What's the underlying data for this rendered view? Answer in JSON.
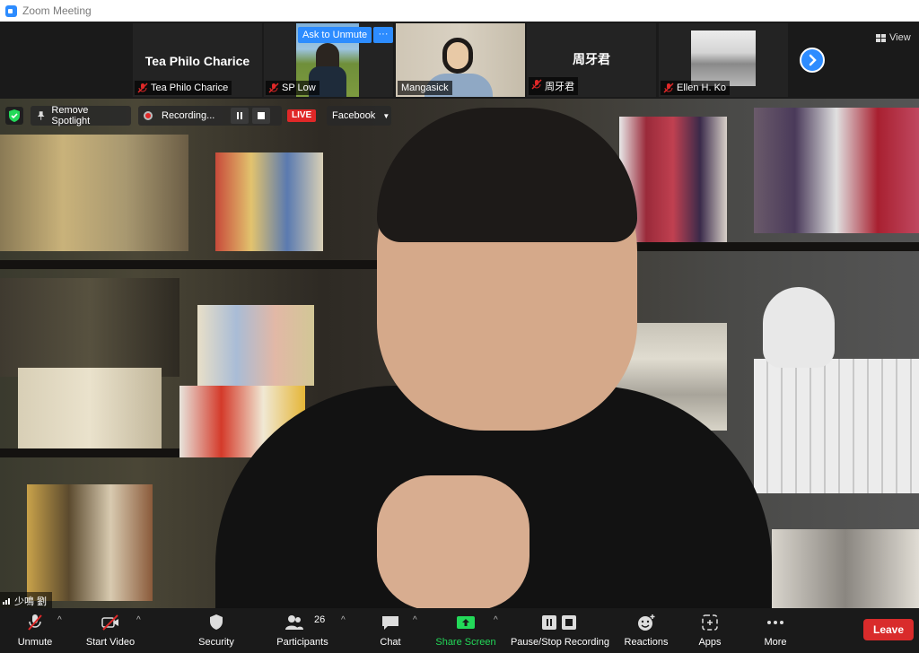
{
  "window": {
    "title": "Zoom Meeting"
  },
  "gallery": {
    "tiles": [
      {
        "name": "Tea Philo Charice",
        "center_name": "Tea Philo Charice",
        "muted": true
      },
      {
        "name": "SP Low",
        "muted": true,
        "ask_unmute": "Ask to Unmute",
        "more": "···"
      },
      {
        "name": "Mangasick",
        "muted": false
      },
      {
        "name": "周牙君",
        "center_name": "周牙君",
        "muted": true
      },
      {
        "name": "Ellen H. Ko",
        "muted": true
      }
    ],
    "view_label": "View"
  },
  "spotlight": {
    "remove_label": "Remove Spotlight",
    "recording_label": "Recording...",
    "live_badge": "LIVE",
    "stream_target": "Facebook",
    "speaker_name": "少鳴 劉"
  },
  "toolbar": {
    "unmute": "Unmute",
    "start_video": "Start Video",
    "security": "Security",
    "participants": "Participants",
    "participants_count": "26",
    "chat": "Chat",
    "share_screen": "Share Screen",
    "pause_stop_recording": "Pause/Stop Recording",
    "reactions": "Reactions",
    "apps": "Apps",
    "more": "More",
    "leave": "Leave"
  },
  "colors": {
    "accent": "#2d8cff",
    "live_red": "#e02828",
    "share_green": "#23d959",
    "leave_red": "#d92b2b",
    "mute_red": "#e02828"
  }
}
